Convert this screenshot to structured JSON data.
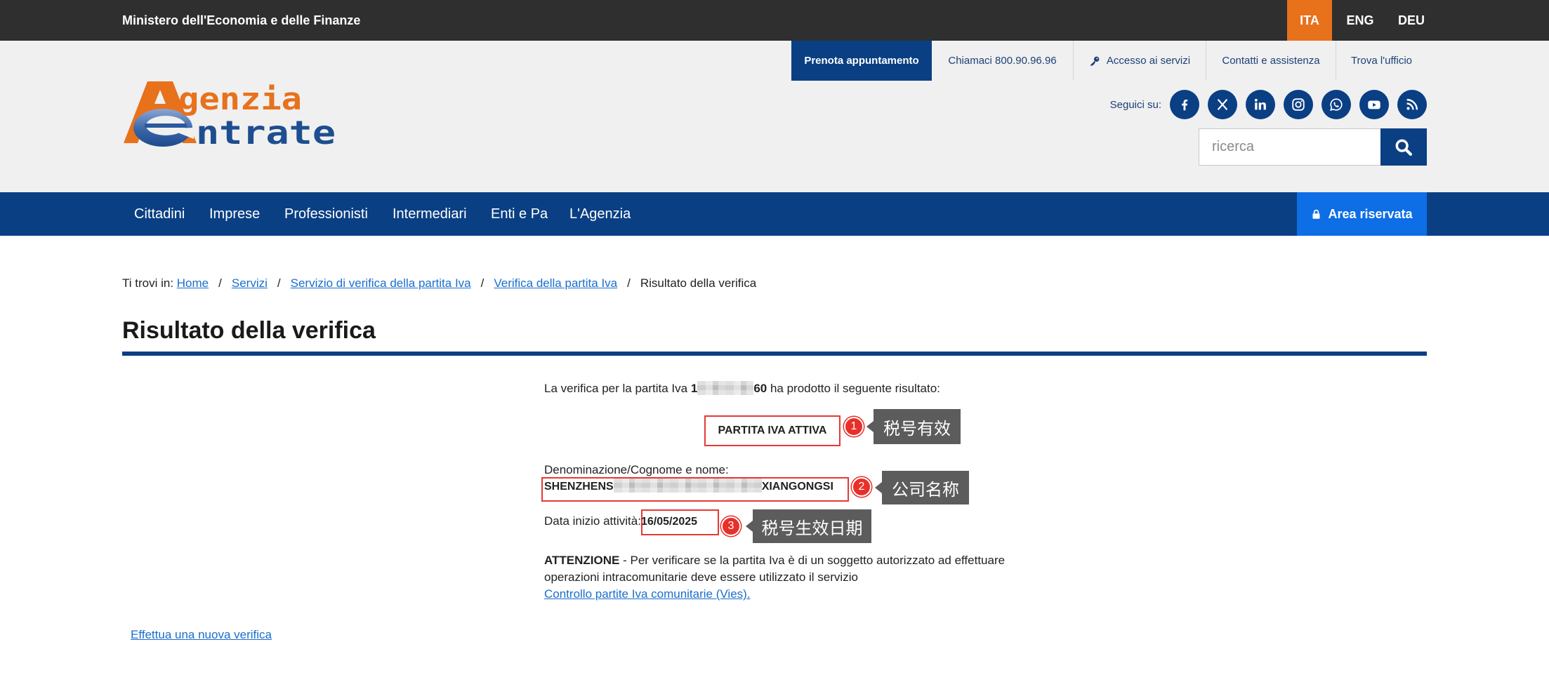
{
  "topbar": {
    "ministry": "Ministero dell'Economia e delle Finanze",
    "languages": [
      "ITA",
      "ENG",
      "DEU"
    ],
    "active_language": "ITA"
  },
  "utility_nav": {
    "book_appointment": "Prenota appuntamento",
    "call": "Chiamaci 800.90.96.96",
    "services_access": "Accesso ai servizi",
    "contacts": "Contatti e assistenza",
    "find_office": "Trova l'ufficio"
  },
  "logo": {
    "line1": "genzia",
    "line2": "ntrate"
  },
  "social": {
    "label": "Seguici su:",
    "icons": [
      "facebook-icon",
      "x-icon",
      "linkedin-icon",
      "instagram-icon",
      "whatsapp-icon",
      "youtube-icon",
      "rss-icon"
    ]
  },
  "search": {
    "placeholder": "ricerca",
    "button_icon": "search-icon"
  },
  "main_nav": {
    "items": [
      "Cittadini",
      "Imprese",
      "Professionisti",
      "Intermediari",
      "Enti e Pa",
      "L'Agenzia"
    ],
    "reserved_area": "Area riservata"
  },
  "breadcrumb": {
    "prefix": "Ti trovi in:",
    "separator": "/",
    "items": [
      "Home",
      "Servizi",
      "Servizio di verifica della partita Iva",
      "Verifica della partita Iva"
    ],
    "current": "Risultato della verifica"
  },
  "page_title": "Risultato della verifica",
  "result": {
    "intro_prefix": "La verifica per la partita Iva",
    "vat_visible_start": "1",
    "vat_visible_end": "60",
    "intro_suffix": "ha prodotto il seguente risultato:",
    "status": "PARTITA IVA ATTIVA",
    "name_label": "Denominazione/Cognome e nome:",
    "name_visible_start": "SHENZHENS",
    "name_visible_end": "XIANGONGSI",
    "start_date_label": "Data inizio attività:",
    "start_date": "16/05/2025",
    "attention_title": "ATTENZIONE",
    "attention_line1": "- Per verificare se la partita Iva è di un soggetto autorizzato ad effettuare",
    "attention_line2": "operazioni intracomunitarie deve essere utilizzato il servizio",
    "vies_link": "Controllo partite Iva comunitarie (Vies)."
  },
  "annotations": [
    {
      "number": "1",
      "label": "税号有效"
    },
    {
      "number": "2",
      "label": "公司名称"
    },
    {
      "number": "3",
      "label": "税号生效日期"
    }
  ],
  "new_check_link": "Effettua una nuova verifica",
  "colors": {
    "topbar_bg": "#2f2f2f",
    "accent_orange": "#e8711c",
    "navy": "#0a3f84",
    "reserved_blue": "#0d6ee6",
    "link_blue": "#1a6ecc",
    "highlight_red": "#e53935",
    "annotation_bg": "#5c5c5c"
  }
}
